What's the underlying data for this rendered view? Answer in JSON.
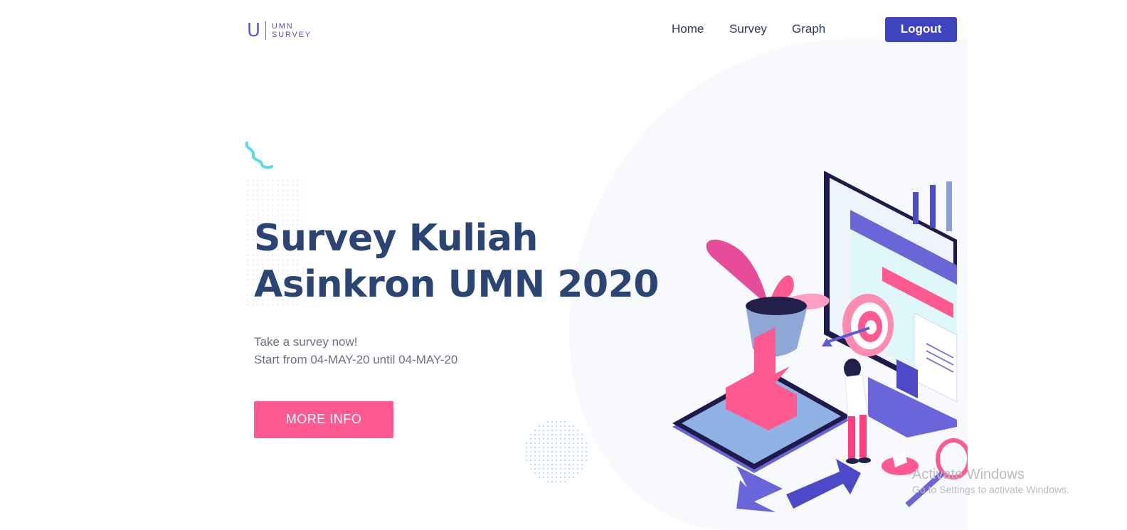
{
  "logo": {
    "mark": "U",
    "line1": "UMN",
    "line2": "SURVEY"
  },
  "nav": {
    "home": "Home",
    "survey": "Survey",
    "graph": "Graph"
  },
  "header": {
    "logout_label": "Logout"
  },
  "hero": {
    "title_line1": "Survey Kuliah",
    "title_line2": "Asinkron UMN 2020",
    "subtitle_line1": "Take a survey now!",
    "subtitle_line2": "Start from 04-MAY-20 until 04-MAY-20",
    "cta_label": "MORE INFO"
  },
  "watermark": {
    "title": "Activate Windows",
    "subtitle": "Go to Settings to activate Windows."
  },
  "colors": {
    "primary": "#3f43bf",
    "accent": "#ff5a8f",
    "heading": "#2a4574",
    "text": "#6b7185"
  },
  "icons": [
    "squiggle-decoration",
    "isometric-survey-illustration",
    "target-icon",
    "plant-icon",
    "arrow-icon"
  ]
}
